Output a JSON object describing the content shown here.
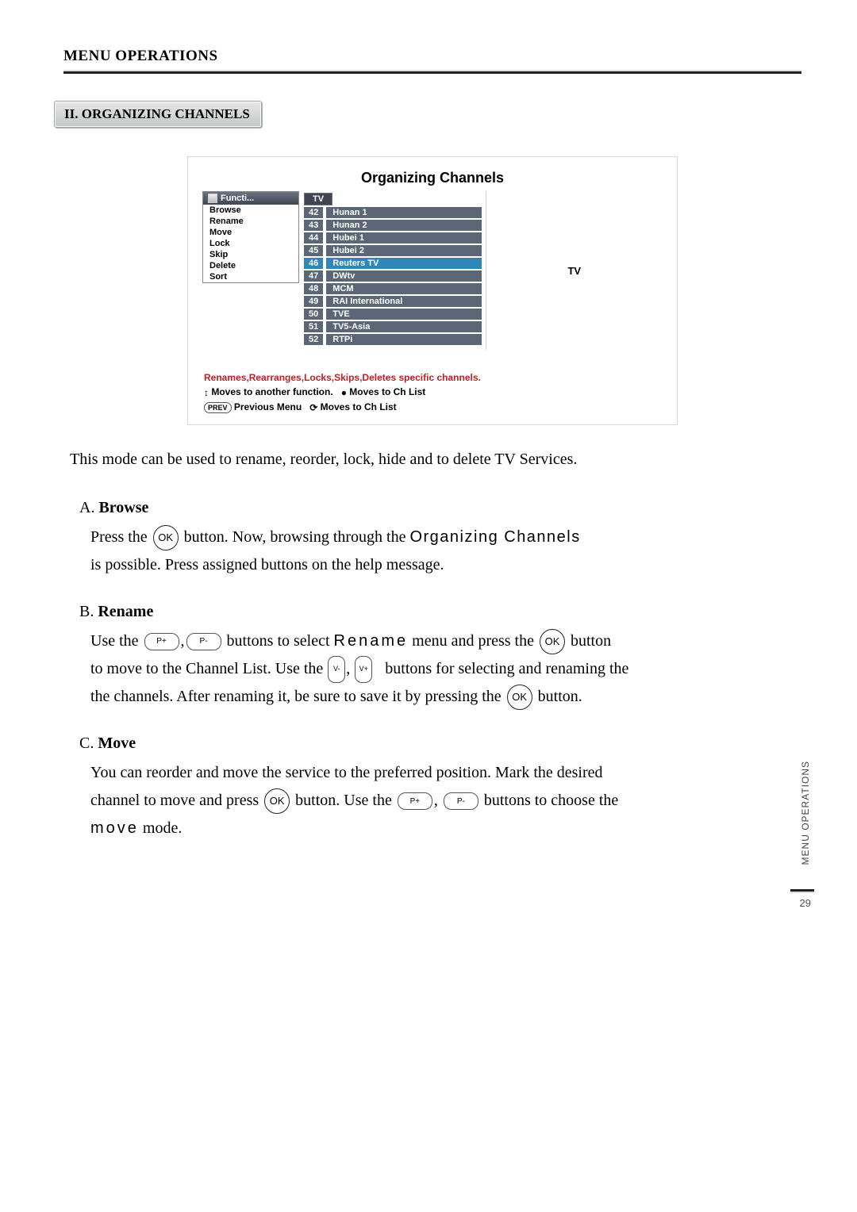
{
  "header": {
    "title": "MENU OPERATIONS"
  },
  "section": {
    "badge": "II. ORGANIZING CHANNELS"
  },
  "shot": {
    "title": "Organizing Channels",
    "sidebar_header": "Functi...",
    "sidebar_items": [
      "Browse",
      "Rename",
      "Move",
      "Lock",
      "Skip",
      "Delete",
      "Sort"
    ],
    "tab": "TV",
    "channels": [
      {
        "num": "42",
        "name": "Hunan 1",
        "selected": false
      },
      {
        "num": "43",
        "name": "Hunan 2",
        "selected": false
      },
      {
        "num": "44",
        "name": "Hubei 1",
        "selected": false
      },
      {
        "num": "45",
        "name": "Hubei 2",
        "selected": false
      },
      {
        "num": "46",
        "name": "Reuters TV",
        "selected": true
      },
      {
        "num": "47",
        "name": "DWtv",
        "selected": false
      },
      {
        "num": "48",
        "name": "MCM",
        "selected": false
      },
      {
        "num": "49",
        "name": "RAI International",
        "selected": false
      },
      {
        "num": "50",
        "name": "TVE",
        "selected": false
      },
      {
        "num": "51",
        "name": "TV5-Asia",
        "selected": false
      },
      {
        "num": "52",
        "name": "RTPi",
        "selected": false
      }
    ],
    "preview_label": "TV",
    "help_desc": "Renames,Rearranges,Locks,Skips,Deletes specific channels.",
    "help_line2a": "Moves to another function.",
    "help_line2b": "Moves to Ch List",
    "help_line3a": "Previous Menu",
    "help_line3b": "Moves to Ch List"
  },
  "intro": "This mode can be used to rename, reorder, lock, hide and to delete TV Services.",
  "sections": {
    "A": {
      "lead": "A. ",
      "title": "Browse",
      "t1": "Press the ",
      "t2": " button. Now, browsing through the ",
      "osd": "Organizing Channels",
      "t3": "is possible. Press assigned buttons on the help message."
    },
    "B": {
      "lead": "B. ",
      "title": "Rename",
      "t1": "Use the ",
      "t2": " buttons to select ",
      "osd": "Rename",
      "t3": " menu and press the ",
      "t4": " button",
      "t5": "to move to the Channel List. Use the ",
      "t6": " buttons for selecting and renaming the",
      "t7": "the channels. After renaming it, be sure to save it by pressing the ",
      "t8": " button."
    },
    "C": {
      "lead": "C. ",
      "title": "Move",
      "t1": "You can reorder and move the service to the preferred position. Mark the desired",
      "t2": "channel to move and press ",
      "t3": " button. Use the ",
      "t4": " buttons to choose the",
      "osd": "move",
      "t5": " mode."
    }
  },
  "buttons": {
    "ok": "OK",
    "p_plus": "P+",
    "p_minus": "P-",
    "v_minus": "V-",
    "v_plus": "V+",
    "prev": "PREV"
  },
  "side": {
    "label": "MENU OPERATIONS"
  },
  "page_number": "29"
}
